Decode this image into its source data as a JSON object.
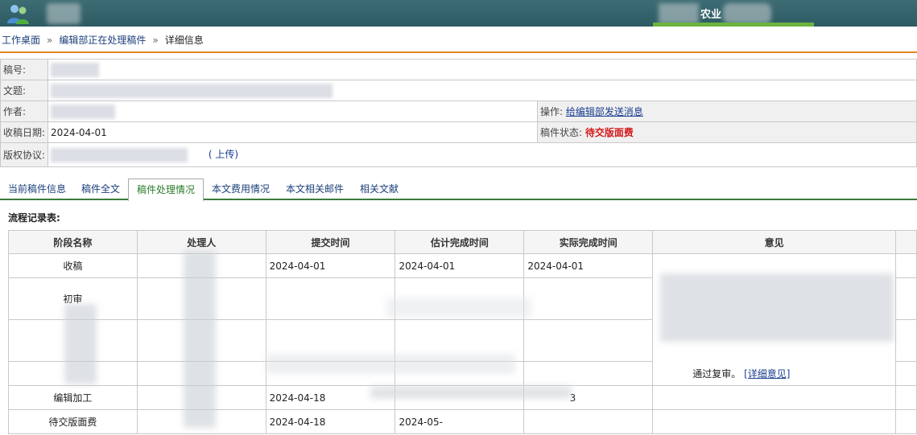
{
  "topbar": {
    "org": "农业"
  },
  "breadcrumb": {
    "home": "工作桌面",
    "sep": "»",
    "section": "编辑部正在处理稿件",
    "current": "详细信息"
  },
  "info": {
    "id_label": "稿号:",
    "title_label": "文题:",
    "author_label": "作者:",
    "op_label": "操作:",
    "op_link": "给编辑部发送消息",
    "received_label": "收稿日期:",
    "received_value": "2024-04-01",
    "status_label": "稿件状态:",
    "status_value": "待交版面费",
    "copyright_label": "版权协议:",
    "upload_text": "( 上传)"
  },
  "tabs": [
    "当前稿件信息",
    "稿件全文",
    "稿件处理情况",
    "本文费用情况",
    "本文相关邮件",
    "相关文献"
  ],
  "active_tab": 2,
  "flow": {
    "title": "流程记录表:",
    "headers": [
      "阶段名称",
      "处理人",
      "提交时间",
      "估计完成时间",
      "实际完成时间",
      "意见"
    ],
    "rows": [
      {
        "stage": "收稿",
        "submit": "2024-04-01",
        "est": "2024-04-01",
        "actual": "2024-04-01",
        "opinion": ""
      },
      {
        "stage": "初审",
        "submit": "",
        "est": "",
        "actual": "",
        "opinion": ""
      },
      {
        "stage": "",
        "submit": "",
        "est": "",
        "actual": "",
        "opinion": "通过复审。",
        "opinion_link": "[详细意见]"
      },
      {
        "stage": "",
        "submit": "",
        "est": "",
        "actual": "",
        "opinion": ""
      },
      {
        "stage": "编辑加工",
        "submit": "2024-04-18",
        "est": "",
        "actual": "3",
        "opinion": ""
      },
      {
        "stage": "待交版面费",
        "submit": "2024-04-18",
        "est": "2024-05-",
        "actual": "",
        "opinion": ""
      }
    ]
  },
  "colors": {
    "topbar": "#2d5a63",
    "accent_green": "#6db23f",
    "breadcrumb_line": "#e08a1e",
    "status_red": "#d41a1a",
    "tab_green": "#2b7a2b"
  }
}
